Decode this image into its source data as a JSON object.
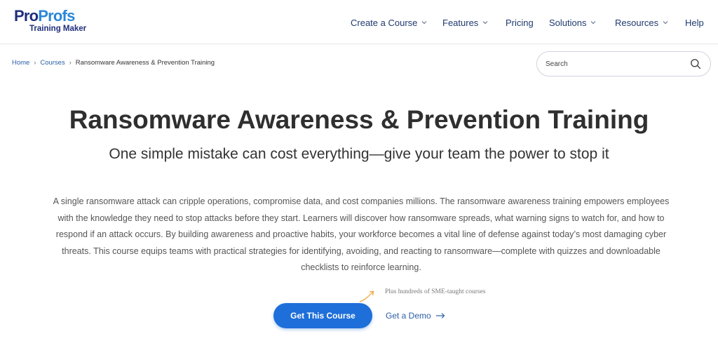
{
  "logo": {
    "part1": "Pro",
    "part2": "Profs",
    "subtitle": "Training Maker"
  },
  "nav": {
    "create_course": "Create a Course",
    "features": "Features",
    "pricing": "Pricing",
    "solutions": "Solutions",
    "resources": "Resources",
    "help": "Help"
  },
  "breadcrumb": {
    "home": "Home",
    "courses": "Courses",
    "current": "Ransomware Awareness & Prevention Training",
    "separator": "›"
  },
  "search": {
    "placeholder": "Search",
    "value": ""
  },
  "hero": {
    "title": "Ransomware Awareness & Prevention Training",
    "subtitle": "One simple mistake can cost everything—give your team the power to stop it",
    "description": "A single ransomware attack can cripple operations, compromise data, and cost companies millions. The ransomware awareness training empowers employees with the knowledge they need to stop attacks before they start. Learners will discover how ransomware spreads, what warning signs to watch for, and how to respond if an attack occurs. By building awareness and proactive habits, your workforce becomes a vital line of defense against today’s most damaging cyber threats. This course equips teams with practical strategies for identifying, avoiding, and reacting to ransomware—complete with quizzes and downloadable checklists to reinforce learning."
  },
  "cta": {
    "note": "Plus hundreds of SME-taught courses",
    "primary_label": "Get This Course",
    "secondary_label": "Get a Demo"
  },
  "colors": {
    "brand_dark": "#1f2d7a",
    "brand_light": "#2a86d9",
    "primary_button": "#1e6fd9",
    "link": "#2a5ea8",
    "note_arrow": "#f0a030"
  },
  "icons": {
    "search": "search-icon",
    "chevron": "chevron-down-icon",
    "arrow": "arrow-right-icon",
    "note_arrow": "curved-arrow-icon"
  }
}
